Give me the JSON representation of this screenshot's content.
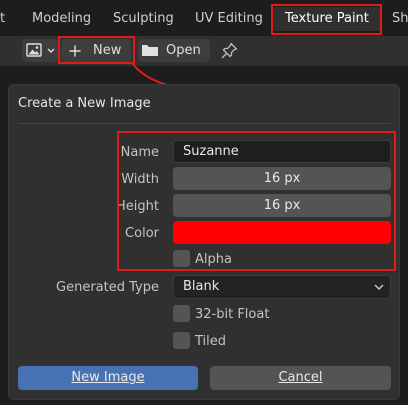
{
  "tabs": [
    {
      "label": "t"
    },
    {
      "label": "Modeling"
    },
    {
      "label": "Sculpting"
    },
    {
      "label": "UV Editing"
    },
    {
      "label": "Texture Paint"
    },
    {
      "label": "Sh"
    }
  ],
  "toolbar": {
    "new_label": "New",
    "open_label": "Open"
  },
  "panel": {
    "title": "Create a New Image",
    "name": {
      "label": "Name",
      "value": "Suzanne"
    },
    "width": {
      "label": "Width",
      "value": "16 px"
    },
    "height": {
      "label": "Height",
      "value": "16 px"
    },
    "color": {
      "label": "Color",
      "value": "#ff0000"
    },
    "alpha": {
      "label": "Alpha",
      "checked": false
    },
    "generated_type": {
      "label": "Generated Type",
      "value": "Blank"
    },
    "float32": {
      "label": "32-bit Float",
      "checked": false
    },
    "tiled": {
      "label": "Tiled",
      "checked": false
    },
    "new_image_button": "New Image",
    "cancel_button": "Cancel"
  },
  "colors": {
    "highlight": "#e01b1b",
    "primary_button": "#4772b3",
    "accent_color_field": "#ff0000"
  }
}
